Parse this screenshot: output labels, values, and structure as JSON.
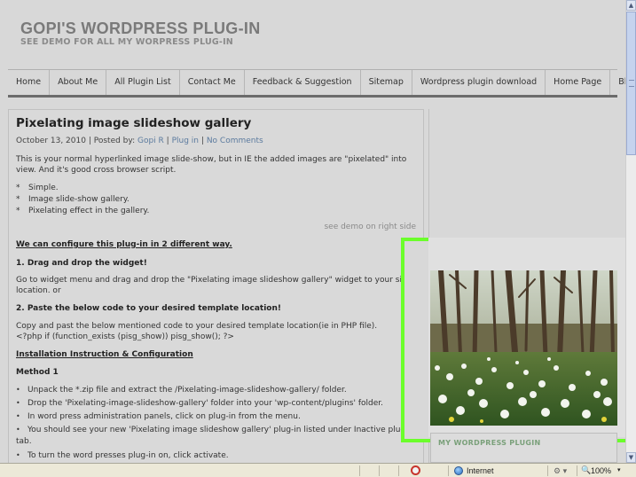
{
  "site": {
    "title": "GOPI'S WORDPRESS PLUG-IN",
    "subtitle": "SEE DEMO FOR ALL MY WORPRESS PLUG-IN"
  },
  "nav": {
    "items": [
      {
        "label": "Home"
      },
      {
        "label": "About Me"
      },
      {
        "label": "All Plugin List"
      },
      {
        "label": "Contact Me"
      },
      {
        "label": "Feedback & Suggestion"
      },
      {
        "label": "Sitemap"
      },
      {
        "label": "Wordpress plugin download"
      },
      {
        "label": "Home Page"
      },
      {
        "label": "Blog"
      }
    ]
  },
  "post": {
    "title": "Pixelating image slideshow gallery",
    "date": "October 13, 2010",
    "posted_by_label": "| Posted by:",
    "author": "Gopi R",
    "separator": "|",
    "category": "Plug in",
    "comments": "No Comments",
    "intro_line1": "This is your normal hyperlinked image slide-show, but in IE the added images are \"pixelated\" into",
    "intro_line2": "view. And it's good cross browser script.",
    "features": [
      "Simple.",
      "Image slide-show gallery.",
      "Pixelating effect in the gallery."
    ],
    "feature_marker": "*",
    "demo_note": "see demo on right side",
    "configure_heading": "We can configure this plug-in in 2 different way.",
    "step1_heading": "1. Drag and drop the widget!",
    "step1_line1": "Go to widget menu and drag and drop the \"Pixelating image slideshow gallery\" widget to your sidel ar",
    "step1_line2": "location. or",
    "step2_heading": "2. Paste the below code to your desired template location!",
    "step2_line1": "Copy and past the below mentioned code to your desired template location(ie in PHP file).",
    "step2_code": "<?php if (function_exists (pisg_show)) pisg_show(); ?>",
    "install_heading": "Installation Instruction & Configuration",
    "method_heading": "Method 1",
    "steps": [
      "Unpack the *.zip file and extract the /Pixelating-image-slideshow-gallery/ folder.",
      "Drop the 'Pixelating-image-slideshow-gallery' folder into your 'wp-content/plugins' folder.",
      "In word press administration panels, click on plug-in from the menu.",
      "You should see your new 'Pixelating image slideshow gallery' plug-in listed under Inactive plug-"
    ],
    "steps_wrap": "tab.",
    "last_step": "To turn the word presses plug-in on, click activate.",
    "bullet_char": "•"
  },
  "sidebar": {
    "widget_title": "MY WORDPRESS PLUGIN"
  },
  "statusbar": {
    "zone": "Internet",
    "zoom": "100%"
  },
  "colors": {
    "highlight": "#6bff2b",
    "link": "#5b7a9e"
  }
}
